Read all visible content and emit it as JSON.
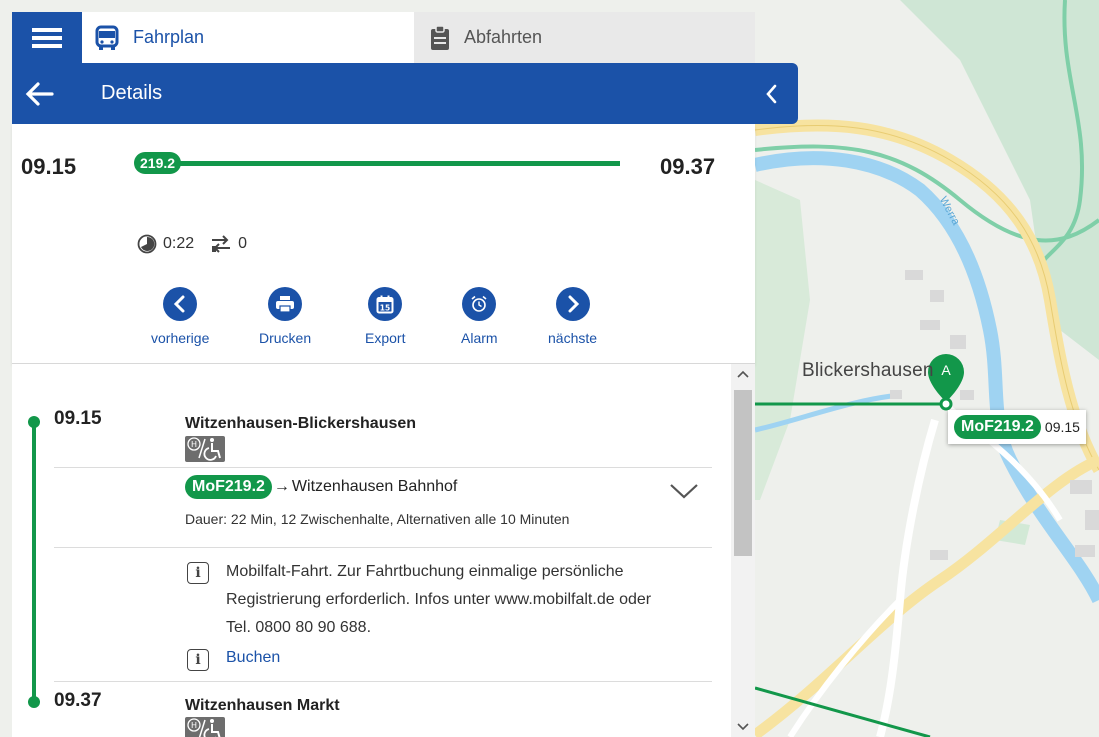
{
  "tabs": {
    "menu_icon": "hamburger-menu-icon",
    "fahrplan": {
      "label": "Fahrplan",
      "icon": "bus-icon"
    },
    "abfahrten": {
      "label": "Abfahrten",
      "icon": "clipboard-icon"
    }
  },
  "header": {
    "title": "Details",
    "back_icon": "arrow-left-icon",
    "collapse_icon": "chevron-left-icon"
  },
  "summary": {
    "departure": "09.15",
    "arrival": "09.37",
    "line": "219.2",
    "duration": "0:22",
    "transfers": "0"
  },
  "actions": [
    {
      "label": "vorherige",
      "icon": "chevron-left-icon"
    },
    {
      "label": "Drucken",
      "icon": "printer-icon"
    },
    {
      "label": "Export",
      "icon": "calendar-icon"
    },
    {
      "label": "Alarm",
      "icon": "alarm-clock-icon"
    },
    {
      "label": "nächste",
      "icon": "chevron-right-icon"
    }
  ],
  "journey": {
    "start": {
      "time": "09.15",
      "name": "Witzenhausen-Blickershausen"
    },
    "leg": {
      "line": "MoF219.2",
      "arrow": "→",
      "destination": "Witzenhausen Bahnhof",
      "duration_text": "Dauer: 22 Min, 12 Zwischenhalte, Alternativen alle 10 Minuten"
    },
    "info": {
      "text": "Mobilfalt-Fahrt. Zur Fahrtbuchung einmalige persönliche Registrierung erforderlich. Infos unter www.mobilfalt.de oder Tel. 0800 80 90 688.",
      "book_label": "Buchen"
    },
    "end": {
      "time": "09.37",
      "name": "Witzenhausen Markt"
    }
  },
  "map": {
    "place_label": "Blickershausen",
    "river_label": "Werra",
    "marker_label": "A",
    "callout": {
      "line": "MoF219.2",
      "time": "09.15"
    }
  },
  "colors": {
    "brand_blue": "#1b52a8",
    "line_green": "#12974a",
    "river_blue": "#9fd3f2",
    "forest_green": "#cfe6d5",
    "road_yellow": "#f7e3a0"
  }
}
